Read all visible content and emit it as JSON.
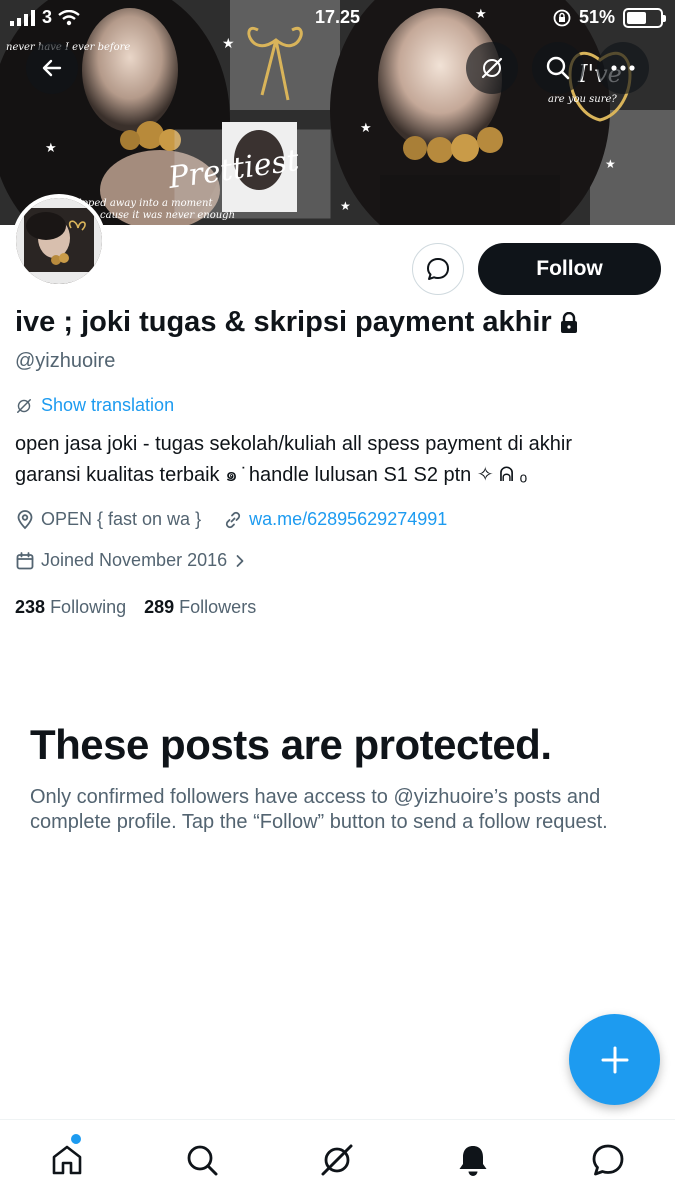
{
  "status_bar": {
    "carrier": "3",
    "time": "17.25",
    "battery": "51%"
  },
  "banner": {
    "texts": [
      "never have I ever before",
      "Prettiest",
      "are you sure?",
      "I've",
      "slipped away into a moment",
      "cause it was never enough"
    ]
  },
  "profile": {
    "display_name": "ive ; joki tugas & skripsi payment akhir",
    "handle": "@yizhuoire",
    "show_translation": "Show translation",
    "bio_line1": "open jasa joki - tugas sekolah/kuliah all spess payment di akhir",
    "bio_line2": "garansi kualitas terbaik ๑ ̇ handle lulusan S1 S2 ptn ✧ ᕱ ₒ",
    "location": "OPEN { fast on wa }",
    "link": "wa.me/62895629274991",
    "joined": "Joined November 2016",
    "following_count": "238",
    "following_label": "Following",
    "followers_count": "289",
    "followers_label": "Followers"
  },
  "actions": {
    "follow_label": "Follow"
  },
  "protected": {
    "title": "These posts are protected.",
    "text": "Only confirmed followers have access to @yizhuoire’s posts and complete profile. Tap the “Follow” button to send a follow request."
  },
  "icons": {
    "back": "back-arrow-icon",
    "grok": "grok-icon",
    "search": "search-icon",
    "more": "more-icon",
    "message": "message-icon",
    "lock": "lock-icon",
    "fab": "plus-icon"
  },
  "colors": {
    "accent": "#1d9bf0",
    "text": "#0f1419",
    "secondary": "#536471",
    "follow_bg": "#0f1419"
  }
}
